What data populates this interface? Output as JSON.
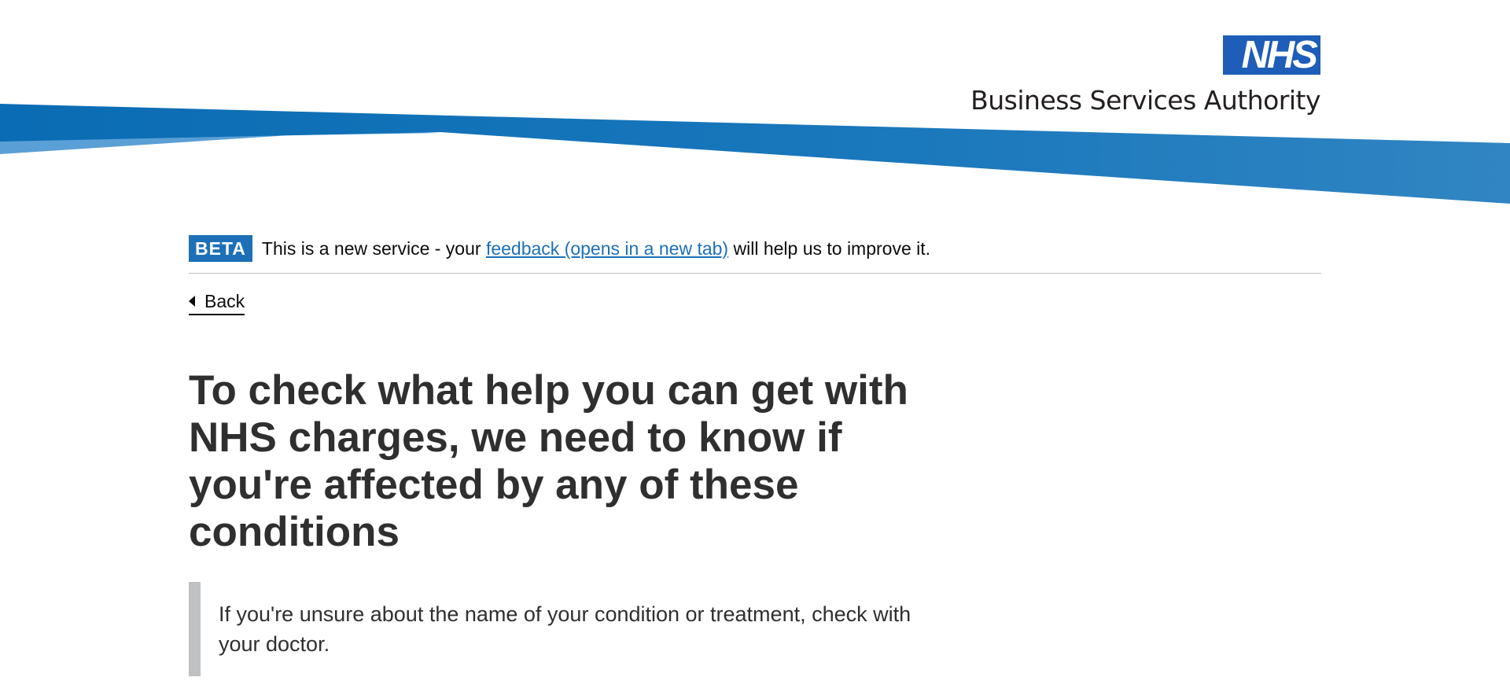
{
  "header": {
    "logo_text": "NHS",
    "org_name": "Business Services Authority",
    "colors": {
      "swoosh_dark": "#0d6fb5",
      "swoosh_light": "#5a9fd6",
      "logo_blue": "#1e5db8"
    }
  },
  "phase_banner": {
    "tag": "BETA",
    "text_before": "This is a new service - your ",
    "link_text": "feedback (opens in a new tab)",
    "text_after": " will help us to improve it."
  },
  "back_link": {
    "label": "Back",
    "icon": "chevron-left-icon"
  },
  "main": {
    "heading": "To check what help you can get with NHS charges, we need to know if you're affected by any of these conditions",
    "inset_text": "If you're unsure about the name of your condition or treatment, check with your doctor."
  }
}
